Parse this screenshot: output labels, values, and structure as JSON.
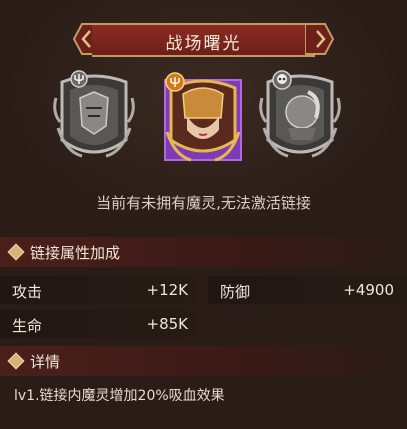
{
  "header": {
    "title": "战场曙光"
  },
  "cards": [
    {
      "name": "card-1",
      "state": "locked",
      "emblem": "trident-badge-icon"
    },
    {
      "name": "card-2",
      "state": "owned",
      "emblem": "trident-badge-icon"
    },
    {
      "name": "card-3",
      "state": "locked",
      "emblem": "skull-badge-icon"
    }
  ],
  "hint": "当前有未拥有魔灵,无法激活链接",
  "link_bonus": {
    "title": "链接属性加成",
    "stats": [
      {
        "label": "攻击",
        "value": "+12K"
      },
      {
        "label": "防御",
        "value": "+4900"
      },
      {
        "label": "生命",
        "value": "+85K"
      }
    ]
  },
  "details": {
    "title": "详情",
    "text": "lv1.链接内魔灵增加20%吸血效果"
  },
  "colors": {
    "banner": "#7a241d",
    "accent_gold": "#d9b27a",
    "owned_border": "#8e3bc9"
  }
}
